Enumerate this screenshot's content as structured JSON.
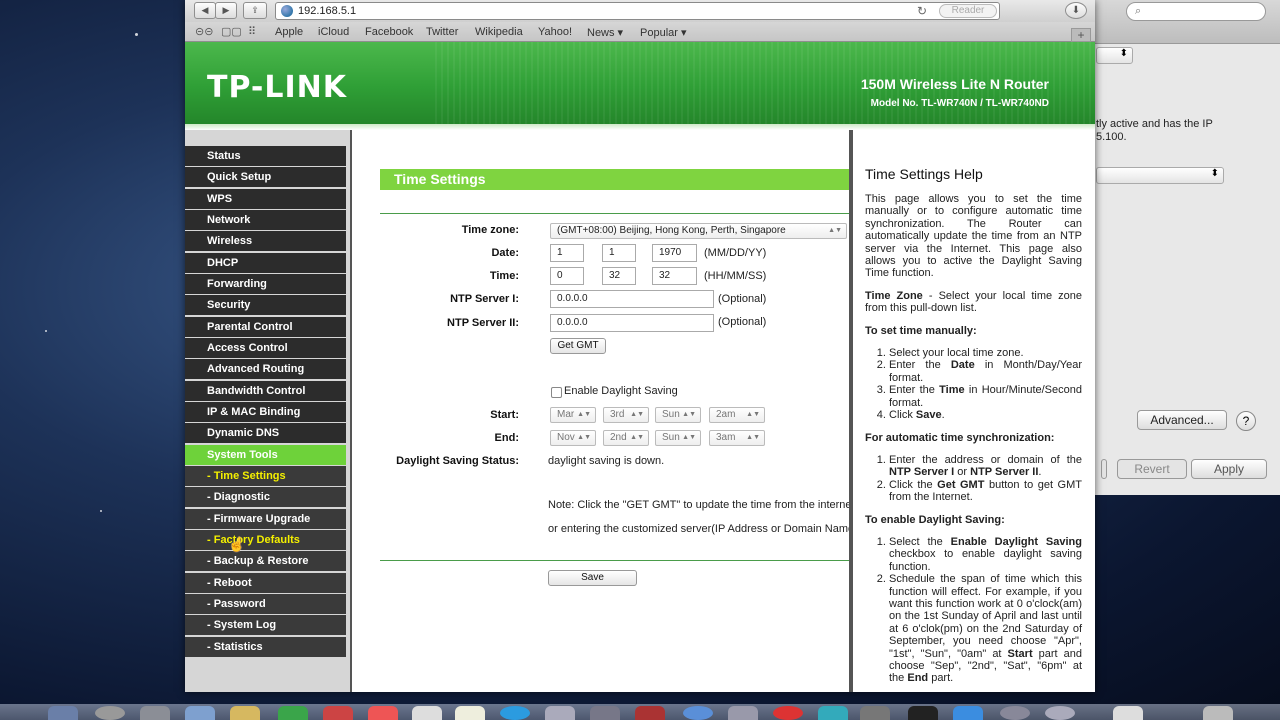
{
  "browser": {
    "url": "192.168.5.1",
    "reader": "Reader",
    "bookmarks": [
      "Apple",
      "iCloud",
      "Facebook",
      "Twitter",
      "Wikipedia",
      "Yahoo!",
      "News ▾",
      "Popular ▾"
    ]
  },
  "router": {
    "logo": "TP-LINK",
    "product": "150M Wireless Lite N Router",
    "model": "Model No. TL-WR740N / TL-WR740ND"
  },
  "menu": [
    {
      "label": "Status"
    },
    {
      "label": "Quick Setup"
    },
    {
      "label": "WPS"
    },
    {
      "label": "Network"
    },
    {
      "label": "Wireless"
    },
    {
      "label": "DHCP"
    },
    {
      "label": "Forwarding"
    },
    {
      "label": "Security"
    },
    {
      "label": "Parental Control"
    },
    {
      "label": "Access Control"
    },
    {
      "label": "Advanced Routing"
    },
    {
      "label": "Bandwidth Control"
    },
    {
      "label": "IP & MAC Binding"
    },
    {
      "label": "Dynamic DNS"
    },
    {
      "label": "System Tools"
    },
    {
      "label": "- Time Settings"
    },
    {
      "label": "- Diagnostic"
    },
    {
      "label": "- Firmware Upgrade"
    },
    {
      "label": "- Factory Defaults"
    },
    {
      "label": "- Backup & Restore"
    },
    {
      "label": "- Reboot"
    },
    {
      "label": "- Password"
    },
    {
      "label": "- System Log"
    },
    {
      "label": "- Statistics"
    }
  ],
  "form": {
    "title": "Time Settings",
    "timezone_label": "Time zone:",
    "timezone_value": "(GMT+08:00) Beijing, Hong Kong, Perth, Singapore",
    "date_label": "Date:",
    "date_month": "1",
    "date_day": "1",
    "date_year": "1970",
    "date_hint": "(MM/DD/YY)",
    "time_label": "Time:",
    "time_h": "0",
    "time_m": "32",
    "time_s": "32",
    "time_hint": "(HH/MM/SS)",
    "ntp1_label": "NTP Server I:",
    "ntp1_value": "0.0.0.0",
    "ntp2_label": "NTP Server II:",
    "ntp2_value": "0.0.0.0",
    "optional": "(Optional)",
    "get_gmt": "Get GMT",
    "dst_checkbox": "Enable Daylight Saving",
    "start_label": "Start:",
    "start": [
      "Mar",
      "3rd",
      "Sun",
      "2am"
    ],
    "end_label": "End:",
    "end": [
      "Nov",
      "2nd",
      "Sun",
      "3am"
    ],
    "dst_status_label": "Daylight Saving Status:",
    "dst_status_value": "daylight saving is down.",
    "note1": "Note: Click the \"GET GMT\" to update the time from the internet",
    "note2": "or entering the customized server(IP Address or Domain Name",
    "save": "Save"
  },
  "help": {
    "title": "Time Settings Help",
    "intro": "This page allows you to set the time manually or to configure automatic time synchronization. The Router can automatically update the time from an NTP server via the Internet. This page also allows you to active the Daylight Saving Time function.",
    "tz_bold": "Time Zone",
    "tz_text": " - Select your local time zone from this pull-down list.",
    "manual_head": "To set time manually:",
    "manual_1": "Select your local time zone.",
    "manual_2a": "Enter the ",
    "manual_2b": "Date",
    "manual_2c": " in Month/Day/Year format.",
    "manual_3a": "Enter the ",
    "manual_3b": "Time",
    "manual_3c": " in Hour/Minute/Second format.",
    "manual_4a": "Click ",
    "manual_4b": "Save",
    "manual_4c": ".",
    "auto_head": "For automatic time synchronization:",
    "auto_1a": "Enter the address or domain of the ",
    "auto_1b": "NTP Server I",
    "auto_1c": " or ",
    "auto_1d": "NTP Server II",
    "auto_1e": ".",
    "auto_2a": "Click the ",
    "auto_2b": "Get GMT",
    "auto_2c": " button to get GMT from the Internet.",
    "dst_head": "To enable Daylight Saving:",
    "dst_1a": "Select the ",
    "dst_1b": "Enable Daylight Saving",
    "dst_1c": " checkbox to enable daylight saving function.",
    "dst_2a": "Schedule the span of time which this function will effect. For example, if you want this function work at 0 o'clock(am) on the 1st Sunday of April and last until at 6 o'clok(pm) on the 2nd Saturday of September, you need choose \"Apr\", \"1st\", \"Sun\", \"0am\" at ",
    "dst_2b": "Start",
    "dst_2c": " part and choose \"Sep\", \"2nd\", \"Sat\", \"6pm\" at the ",
    "dst_2d": "End",
    "dst_2e": " part."
  },
  "background_window": {
    "text1": "tly active and has the IP",
    "text2": "5.100.",
    "advanced": "Advanced...",
    "help": "?",
    "revert": "Revert",
    "apply": "Apply"
  }
}
